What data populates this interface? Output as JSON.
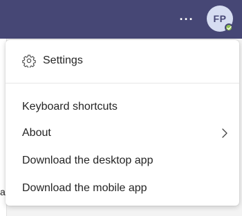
{
  "header": {
    "more_label": "···",
    "avatar_initials": "FP",
    "presence_status": "available",
    "background_color": "#464775"
  },
  "menu": {
    "settings_label": "Settings",
    "items": [
      {
        "label": "Keyboard shortcuts"
      },
      {
        "label": "About",
        "has_submenu": true
      },
      {
        "label": "Download the desktop app"
      },
      {
        "label": "Download the mobile app"
      }
    ]
  },
  "background": {
    "edge_text": "a"
  },
  "icons": {
    "settings": "gear-icon",
    "about_submenu": "chevron-right-icon",
    "presence": "checkmark-icon"
  },
  "colors": {
    "presence_available": "#92c353",
    "avatar_background": "#d6ddf1",
    "text": "#242424"
  }
}
